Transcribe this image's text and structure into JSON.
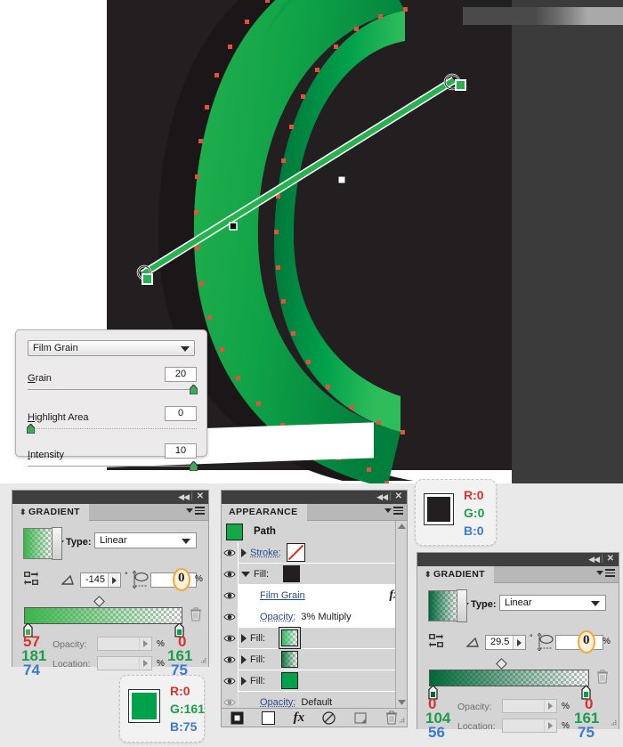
{
  "artwork": {
    "description": "Adobe Illustrator canvas with green letter C extrude artwork on dark background",
    "colors": {
      "green_light": "#22b14c",
      "green_mid": "#00a14b",
      "green_dark": "#00713a",
      "anchor_point": "#e8503a",
      "background_dark": "#231f20",
      "background_dark2": "#3b3b3b",
      "paper_white": "#ffffff"
    }
  },
  "filmgrain_dialog": {
    "effect_name": "Film Grain",
    "sliders": [
      {
        "label_pre": "G",
        "label_accel": "r",
        "label_post": "ain",
        "label": "Grain",
        "value": "20",
        "knob_pct": 100
      },
      {
        "label_pre": "H",
        "label_accel": "i",
        "label_post": "ghlight Area",
        "label": "Highlight Area",
        "value": "0",
        "knob_pct": 0
      },
      {
        "label_pre": "I",
        "label_accel": "n",
        "label_post": "tensity",
        "label": "Intensity",
        "value": "10",
        "knob_pct": 100
      }
    ]
  },
  "gradient_panel_left": {
    "title": "GRADIENT",
    "type_label": "Type:",
    "type_value": "Linear",
    "angle_value": "-145",
    "degree_symbol": "°",
    "ratio_value": "0",
    "percent_symbol": "%",
    "opacity_label": "Opacity:",
    "opacity_value": "",
    "location_label": "Location:",
    "location_value": "",
    "midpoint_pct": 45,
    "stops": [
      {
        "position": "left",
        "r": "57",
        "g": "181",
        "b": "74",
        "hex": "#39b54a"
      },
      {
        "position": "right",
        "r": "0",
        "g": "161",
        "b": "75",
        "hex": "#00a14b"
      }
    ],
    "bar_gradient": "linear-gradient(90deg,#39b54a 0%,#39b54a 18%,#7fcf9b 55%,#ffffff 100%)"
  },
  "gradient_panel_right": {
    "title": "GRADIENT",
    "type_label": "Type:",
    "type_value": "Linear",
    "angle_value": "29.5",
    "degree_symbol": "°",
    "ratio_value": "0",
    "percent_symbol": "%",
    "opacity_label": "Opacity:",
    "opacity_value": "",
    "location_label": "Location:",
    "location_value": "",
    "midpoint_pct": 43,
    "stops": [
      {
        "position": "left",
        "r": "0",
        "g": "104",
        "b": "56",
        "hex": "#006838"
      },
      {
        "position": "right",
        "r": "0",
        "g": "161",
        "b": "75",
        "hex": "#00a14b"
      }
    ],
    "bar_gradient": "linear-gradient(90deg,#006838 0%,#0c7b42 20%,#5cbb8a 62%,#ffffff 100%)"
  },
  "appearance_panel": {
    "title": "APPEARANCE",
    "target_label": "Path",
    "target_swatch": "#14a84a",
    "rows": [
      {
        "id": "stroke",
        "type": "attribute",
        "label": "Stroke:",
        "swatch": "none",
        "indent": 0,
        "disclosure": "closed",
        "shaded": true
      },
      {
        "id": "fill-1",
        "type": "attribute",
        "label": "Fill:",
        "swatch": "#231f20",
        "indent": 0,
        "disclosure": "open",
        "shaded": true
      },
      {
        "id": "film-grain",
        "type": "effect",
        "label": "Film Grain",
        "indent": 1,
        "fx": "fx",
        "shaded": false
      },
      {
        "id": "fx-opacity",
        "type": "opacity",
        "label": "Opacity:",
        "value": "3% Multiply",
        "indent": 1,
        "shaded": false
      },
      {
        "id": "fill-2",
        "type": "attribute",
        "label": "Fill:",
        "swatch": "gradient-a",
        "indent": 0,
        "disclosure": "closed",
        "shaded": true,
        "selected": true
      },
      {
        "id": "fill-3",
        "type": "attribute",
        "label": "Fill:",
        "swatch": "gradient-b",
        "indent": 0,
        "disclosure": "closed",
        "shaded": true
      },
      {
        "id": "fill-4",
        "type": "attribute",
        "label": "Fill:",
        "swatch": "#00a14b",
        "indent": 0,
        "disclosure": "closed",
        "shaded": true
      },
      {
        "id": "opacity",
        "type": "opacity",
        "label": "Opacity:",
        "value": "Default",
        "indent": 1,
        "shaded": true
      }
    ],
    "footer_buttons": [
      {
        "name": "add-new-stroke-button",
        "icon": "square-filled-icon"
      },
      {
        "name": "add-new-fill-button",
        "icon": "square-outline-icon"
      },
      {
        "name": "add-new-effect-button",
        "icon": "fx-icon"
      },
      {
        "name": "clear-appearance-button",
        "icon": "no-symbol-icon"
      },
      {
        "name": "duplicate-item-button",
        "icon": "duplicate-icon"
      },
      {
        "name": "delete-item-button",
        "icon": "trash-icon"
      }
    ]
  },
  "callout_black": {
    "swatch_hex": "#231f20",
    "r_label": "R:",
    "r_value": "0",
    "g_label": "G:",
    "g_value": "0",
    "b_label": "B:",
    "b_value": "0"
  },
  "callout_green": {
    "swatch_hex": "#00a14b",
    "r_label": "R:",
    "r_value": "0",
    "g_label": "G:",
    "g_value": "161",
    "b_label": "B:",
    "b_value": "75"
  }
}
